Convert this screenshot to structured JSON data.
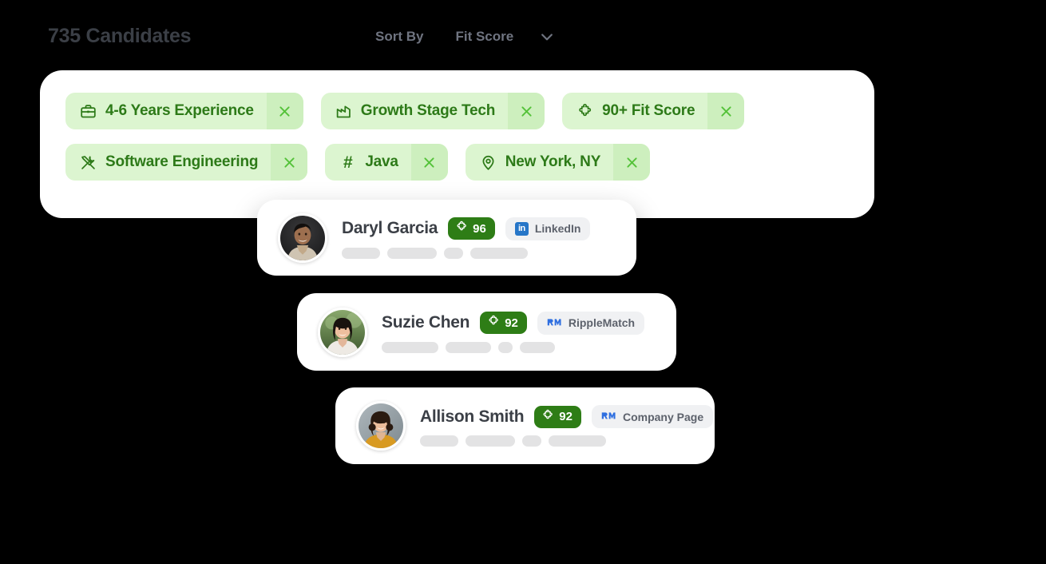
{
  "header": {
    "title": "735 Candidates",
    "sort_label": "Sort By",
    "sort_value": "Fit Score",
    "chevron_icon": "chevron-down-icon"
  },
  "colors": {
    "chip_bg": "#dcf5d0",
    "chip_close_bg": "#cdefbe",
    "chip_text": "#2d7a18",
    "score_badge_bg": "#2e7d16",
    "source_badge_bg": "#f0f1f3",
    "linkedin_blue": "#2676c8",
    "ripplematch_blue": "#2f6fe0",
    "page_bg": "#000000",
    "panel_bg": "#ffffff",
    "skeleton": "#e3e3e4",
    "heading_text": "#3b3f46",
    "muted_text": "#6f7480"
  },
  "filters": {
    "close_label": "×",
    "rows": [
      [
        {
          "label": "4-6 Years Experience",
          "icon": "briefcase-icon"
        },
        {
          "label": "Growth Stage Tech",
          "icon": "factory-icon"
        },
        {
          "label": "90+ Fit Score",
          "icon": "puzzle-icon"
        }
      ],
      [
        {
          "label": "Software Engineering",
          "icon": "tools-icon"
        },
        {
          "label": "Java",
          "icon": "hash-icon"
        },
        {
          "label": "New York, NY",
          "icon": "location-pin-icon"
        }
      ]
    ]
  },
  "candidates": [
    {
      "name": "Daryl Garcia",
      "score": "96",
      "score_icon": "puzzle-icon",
      "source": "LinkedIn",
      "source_icon": "linkedin-icon",
      "avatar": "avatar-daryl-garcia",
      "skeleton_widths": [
        48,
        62,
        24,
        72
      ]
    },
    {
      "name": "Suzie Chen",
      "score": "92",
      "score_icon": "puzzle-icon",
      "source": "RippleMatch",
      "source_icon": "ripplematch-icon",
      "avatar": "avatar-suzie-chen",
      "skeleton_widths": [
        71,
        57,
        18,
        44
      ]
    },
    {
      "name": "Allison Smith",
      "score": "92",
      "score_icon": "puzzle-icon",
      "source": "Company Page",
      "source_icon": "ripplematch-icon",
      "avatar": "avatar-allison-smith",
      "skeleton_widths": [
        48,
        62,
        24,
        72
      ]
    }
  ]
}
